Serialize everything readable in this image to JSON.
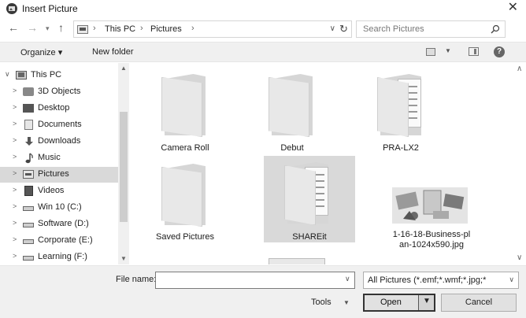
{
  "window": {
    "title": "Insert Picture",
    "close": "✕"
  },
  "nav": {
    "back": "←",
    "forward": "→",
    "recent": "▾",
    "up": "↑",
    "breadcrumb": [
      "This PC",
      "Pictures"
    ],
    "separator": "›",
    "refresh": "↻",
    "address_drop": "∨"
  },
  "search": {
    "placeholder": "Search Pictures"
  },
  "toolbar": {
    "organize": "Organize ▾",
    "new_folder": "New folder",
    "view_drop": "▼",
    "help": "?"
  },
  "tree": [
    {
      "label": "This PC",
      "chevron": "∨",
      "icon": "computer-icon"
    },
    {
      "label": "3D Objects",
      "chevron": ">",
      "icon": "cube-icon"
    },
    {
      "label": "Desktop",
      "chevron": ">",
      "icon": "desktop-icon"
    },
    {
      "label": "Documents",
      "chevron": ">",
      "icon": "document-icon"
    },
    {
      "label": "Downloads",
      "chevron": ">",
      "icon": "download-icon"
    },
    {
      "label": "Music",
      "chevron": ">",
      "icon": "music-icon"
    },
    {
      "label": "Pictures",
      "chevron": ">",
      "icon": "pictures-icon",
      "selected": true
    },
    {
      "label": "Videos",
      "chevron": ">",
      "icon": "video-icon"
    },
    {
      "label": "Win 10 (C:)",
      "chevron": ">",
      "icon": "drive-icon"
    },
    {
      "label": "Software (D:)",
      "chevron": ">",
      "icon": "drive-icon"
    },
    {
      "label": "Corporate (E:)",
      "chevron": ">",
      "icon": "drive-icon"
    },
    {
      "label": "Learning (F:)",
      "chevron": ">",
      "icon": "drive-icon"
    }
  ],
  "files": [
    {
      "name": "Camera Roll",
      "type": "folder-empty"
    },
    {
      "name": "Debut",
      "type": "folder-empty"
    },
    {
      "name": "PRA-LX2",
      "type": "folder-with-docs"
    },
    {
      "name": "Saved Pictures",
      "type": "folder-empty"
    },
    {
      "name": "SHAREit",
      "type": "folder-with-docs",
      "selected": true
    },
    {
      "name": "1-16-18-Business-plan-1024x590.jpg",
      "line1": "1-16-18-Business-pl",
      "line2": "an-1024x590.jpg",
      "type": "image"
    }
  ],
  "scroll": {
    "up": "▲",
    "down": "▼",
    "content_up": "∧",
    "content_down": "∨"
  },
  "bottom": {
    "filename_label": "File name:",
    "filename_value": "",
    "filename_drop": "∨",
    "filetype": "All Pictures (*.emf;*.wmf;*.jpg;*",
    "filetype_drop": "∨",
    "tools": "Tools",
    "tools_drop": "▼",
    "open": "Open",
    "open_split": "▼",
    "cancel": "Cancel"
  }
}
